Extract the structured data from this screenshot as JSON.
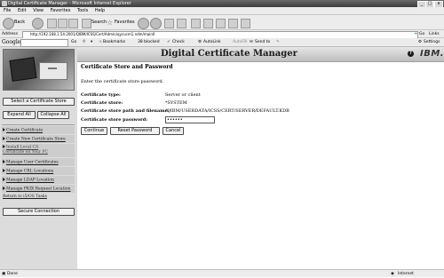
{
  "window": {
    "title": "Digital Certificate Manager - Microsoft Internet Explorer",
    "min": "_",
    "max": "□",
    "close": "x"
  },
  "menu": [
    "File",
    "Edit",
    "View",
    "Favorites",
    "Tools",
    "Help"
  ],
  "toolbar": {
    "back": "Back",
    "search": "Search",
    "favorites": "Favorites"
  },
  "address": {
    "label": "Address",
    "url": "http://192.168.1.54:2001/QIBM/ICSS/Cert/Admin/qycucm1.ndm/main0",
    "go": "Go",
    "links": "Links"
  },
  "google": {
    "logo": "Google",
    "go": "Go",
    "bookmarks": "Bookmarks",
    "blocked": "38 blocked",
    "check": "Check",
    "autolink": "AutoLink",
    "autofill": "AutoFill",
    "sendto": "Send to",
    "settings": "Settings"
  },
  "page": {
    "banner_title": "Digital Certificate Manager",
    "help": "?",
    "ibm": "IBM."
  },
  "sidebar": {
    "select_store": "Select a Certificate Store",
    "expand_all": "Expand All",
    "collapse_all": "Collapse All",
    "items": [
      "Create Certificate",
      "Create New Certificate Store",
      "Install Local CA Certificate on Your PC",
      "Manage User Certificates",
      "Manage CRL Locations",
      "Manage LDAP Location",
      "Manage PKIX Request Location"
    ],
    "return_link": "Return to i5/OS Tasks",
    "secure_connection": "Secure Connection"
  },
  "form": {
    "heading": "Certificate Store and Password",
    "instruction": "Enter the certificate store password.",
    "type_label": "Certificate type:",
    "type_value": "Server or client",
    "store_label": "Certificate store:",
    "store_value": "*SYSTEM",
    "path_label": "Certificate store path and filename:",
    "path_value": "/QIBM/USERDATA/ICSS/CERT/SERVER/DEFAULT.KDB",
    "password_label": "Certificate store password:",
    "password_value": "••••••",
    "continue": "Continue",
    "reset": "Reset Password",
    "cancel": "Cancel"
  },
  "status": {
    "left": "Done",
    "zone": "Internet"
  }
}
